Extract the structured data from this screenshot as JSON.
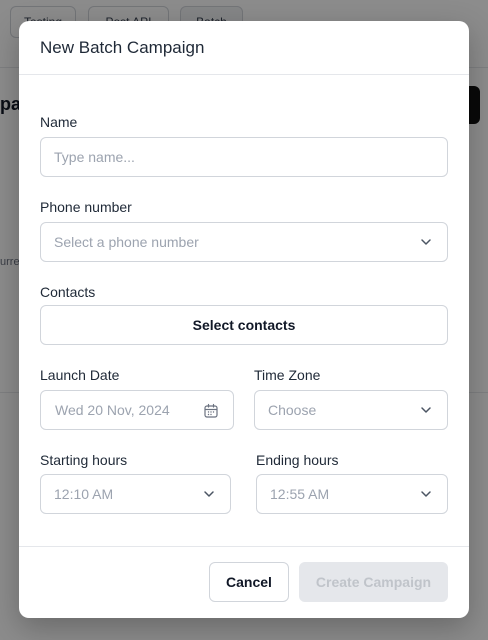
{
  "background": {
    "tabs": [
      "Testing",
      "Post API",
      "Batch"
    ],
    "title_fragment": "pa",
    "side_text": "urre"
  },
  "modal": {
    "title": "New Batch Campaign",
    "name": {
      "label": "Name",
      "placeholder": "Type name..."
    },
    "phone": {
      "label": "Phone number",
      "placeholder": "Select a phone number"
    },
    "contacts": {
      "label": "Contacts",
      "button": "Select contacts"
    },
    "launch_date": {
      "label": "Launch Date",
      "value": "Wed 20 Nov, 2024"
    },
    "time_zone": {
      "label": "Time Zone",
      "placeholder": "Choose"
    },
    "starting_hours": {
      "label": "Starting hours",
      "value": "12:10 AM"
    },
    "ending_hours": {
      "label": "Ending hours",
      "value": "12:55 AM"
    },
    "footer": {
      "cancel": "Cancel",
      "create": "Create Campaign"
    }
  }
}
